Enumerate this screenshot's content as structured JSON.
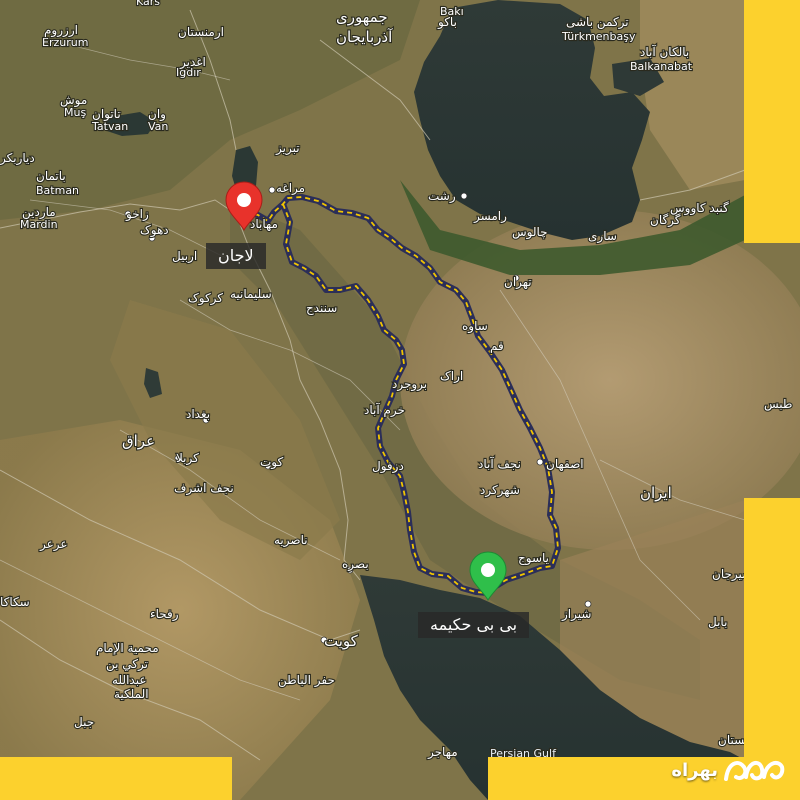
{
  "map": {
    "origin": {
      "name": "لاجان",
      "marker_color": "#e8322b"
    },
    "destination": {
      "name": "بی بی حکیمه",
      "marker_color": "#2fbf4a"
    },
    "route_color": "#2b2e58",
    "route_dash_color": "#f2c600",
    "brand_color": "#fcd12d",
    "labels": [
      "Kars",
      "Erzurum",
      "Muş",
      "Tatvan",
      "Van",
      "Iğdır",
      "Batman",
      "Mardin",
      "Bakı",
      "Türkmenbaşy",
      "Balkanabat",
      "Persian Gulf",
      "ارمنستان",
      "ارزروم",
      "اغدیر",
      "موش",
      "تاتوان",
      "وان",
      "دیاربکر",
      "باتمان",
      "ماردین",
      "جمهوری",
      "آذربایجان",
      "باکو",
      "ترکمن باشی",
      "بالکان آباد",
      "تبریز",
      "مراغه",
      "مهاباد",
      "رشت",
      "رامسر",
      "چالوس",
      "ساری",
      "گنبد کاووس",
      "گرگان",
      "تهران",
      "ساوه",
      "قم",
      "اراک",
      "بروجرد",
      "خرم آباد",
      "دزفول",
      "اصفهان",
      "نجف آباد",
      "شهرکرد",
      "یاسوج",
      "شیراز",
      "سیرجان",
      "ایران",
      "طبس",
      "زاخو",
      "دهوک",
      "اربیل",
      "کرکوک",
      "سلیمانیه",
      "سنندج",
      "بغداد",
      "عراق",
      "کربلا",
      "کوت",
      "نجف اشرف",
      "ناصریه",
      "بصره",
      "کویت",
      "رفحاء",
      "عرعر",
      "حفر الباطن",
      "محمية الإمام",
      "تركي بن",
      "عبدالله",
      "الملكية",
      "جبل",
      "مهاجر",
      "بابل",
      "سیستان",
      "سکاکا"
    ],
    "brand": "بهراه"
  }
}
